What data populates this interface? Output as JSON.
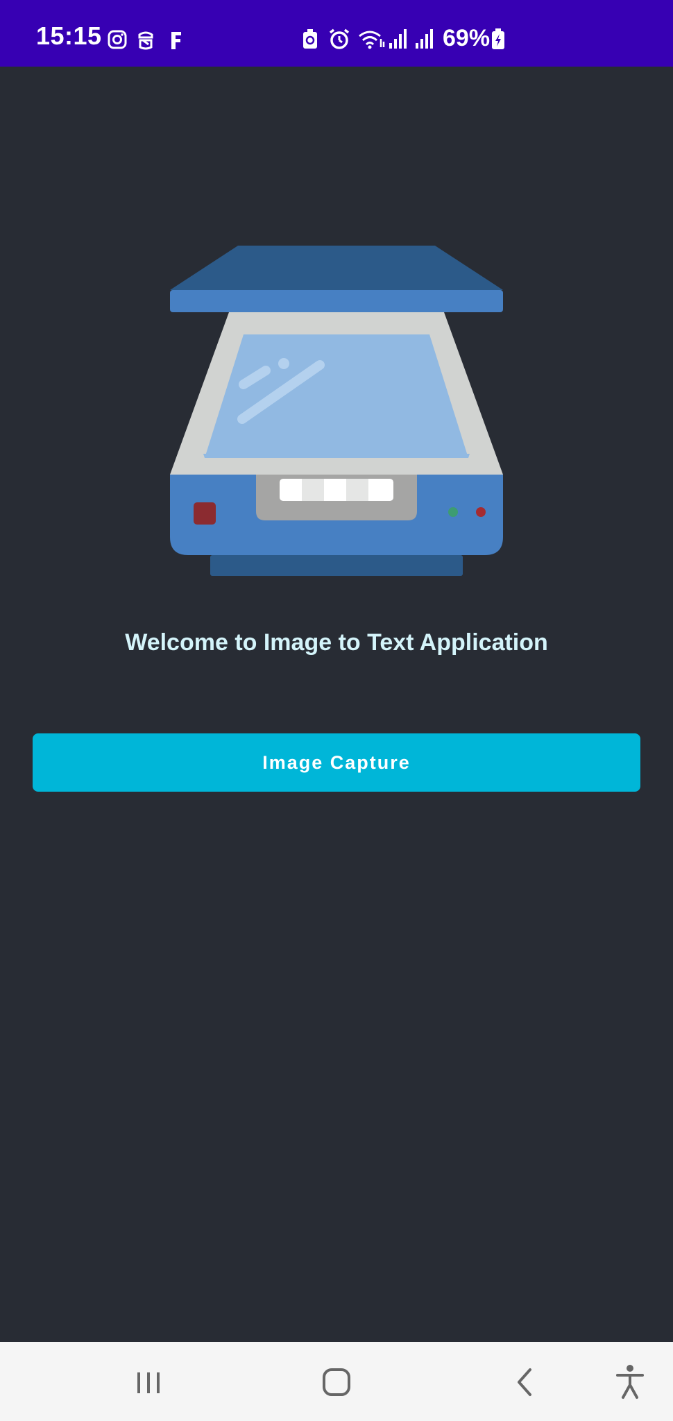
{
  "status_bar": {
    "time": "15:15",
    "battery_percent": "69%",
    "background_color": "#3700b3",
    "left_icons": [
      "instagram-icon",
      "vpn-robot-icon",
      "facebook-f-icon"
    ],
    "right_icons": [
      "battery-saver-icon",
      "alarm-icon",
      "wifi-icon",
      "signal-icon",
      "signal-icon",
      "battery-charging-icon"
    ]
  },
  "main": {
    "background_color": "#282c34",
    "illustration": "scanner-icon",
    "welcome_title": "Welcome to Image to Text Application",
    "capture_button_label": "Image Capture",
    "accent_color": "#00b6d8"
  },
  "nav_bar": {
    "buttons": [
      "recent-apps-icon",
      "home-icon",
      "back-icon",
      "accessibility-icon"
    ]
  }
}
